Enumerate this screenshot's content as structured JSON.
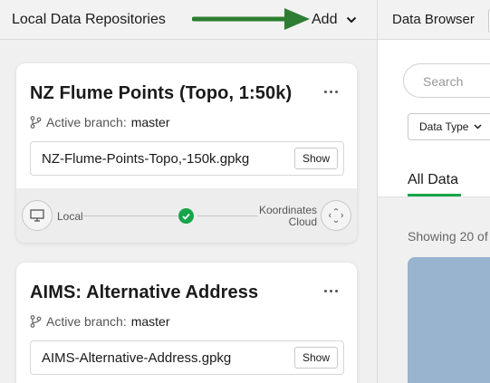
{
  "left_panel": {
    "title": "Local Data Repositories",
    "add_label": "Add"
  },
  "cards": [
    {
      "title": "NZ Flume Points (Topo, 1:50k)",
      "branch_label": "Active branch:",
      "branch_value": "master",
      "file": "NZ-Flume-Points-Topo,-150k.gpkg",
      "show_label": "Show",
      "local_label": "Local",
      "cloud_label_1": "Koordinates",
      "cloud_label_2": "Cloud"
    },
    {
      "title": "AIMS: Alternative Address",
      "branch_label": "Active branch:",
      "branch_value": "master",
      "file": "AIMS-Alternative-Address.gpkg",
      "show_label": "Show"
    }
  ],
  "right_panel": {
    "title": "Data Browser",
    "search_placeholder": "Search",
    "filter_label": "Data Type",
    "tab_all": "All Data",
    "showing_text": "Showing 20 of"
  },
  "colors": {
    "accent_green": "#18a44a",
    "arrow_green": "#2e7d32",
    "map_blue": "#98b4cf"
  }
}
